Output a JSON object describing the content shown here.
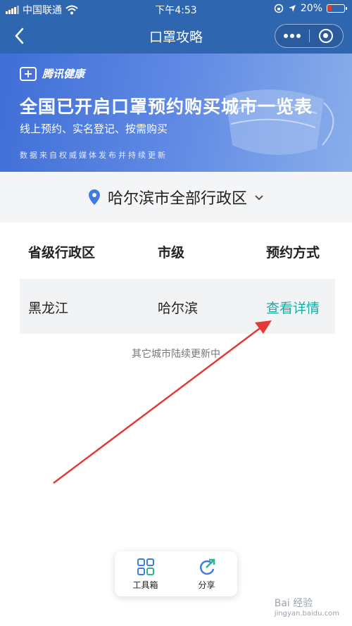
{
  "status_bar": {
    "carrier": "中国联通",
    "time": "下午4:53",
    "battery": "20%"
  },
  "nav": {
    "title": "口罩攻略"
  },
  "banner": {
    "brand": "腾讯健康",
    "headline": "全国已开启口罩预约购买城市一览表",
    "subtitle": "线上预约、实名登记、按需购买",
    "note": "数据来自权威媒体发布并持续更新"
  },
  "region": {
    "selected": "哈尔滨市全部行政区"
  },
  "table": {
    "headers": [
      "省级行政区",
      "市级",
      "预约方式"
    ],
    "rows": [
      {
        "province": "黑龙江",
        "city": "哈尔滨",
        "action": "查看详情"
      }
    ]
  },
  "footnote": "其它城市陆续更新中",
  "toolbar": {
    "toolbox_label": "工具箱",
    "share_label": "分享"
  },
  "watermark": {
    "text": "Bai 经验",
    "sub": "jingyan.baidu.com"
  },
  "colors": {
    "nav": "#2f66b0",
    "link": "#1fa8a6",
    "annotation_arrow": "#e53935"
  }
}
